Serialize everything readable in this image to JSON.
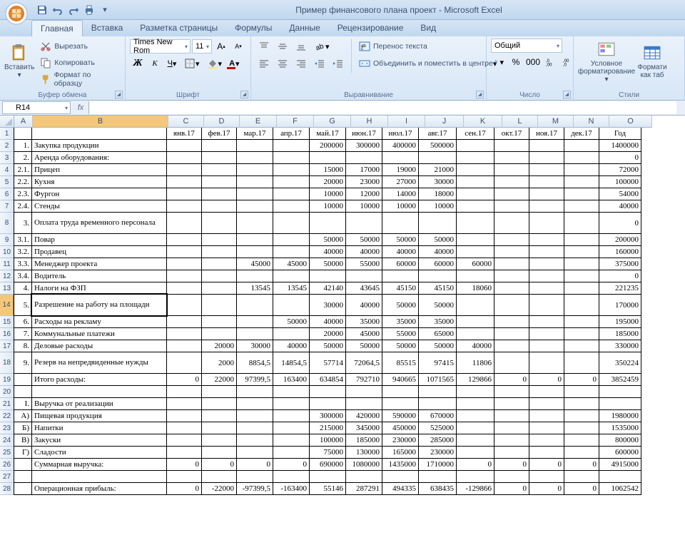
{
  "title": "Пример финансового плана проект - Microsoft Excel",
  "tabs": [
    "Главная",
    "Вставка",
    "Разметка страницы",
    "Формулы",
    "Данные",
    "Рецензирование",
    "Вид"
  ],
  "ribbon": {
    "paste": "Вставить",
    "cut": "Вырезать",
    "copy": "Копировать",
    "fmt_painter": "Формат по образцу",
    "g_clip": "Буфер обмена",
    "font_name": "Times New Rom",
    "font_size": "11",
    "g_font": "Шрифт",
    "wrap": "Перенос текста",
    "merge": "Объединить и поместить в центре",
    "g_align": "Выравнивание",
    "num_fmt": "Общий",
    "g_num": "Число",
    "cond_fmt_l1": "Условное",
    "cond_fmt_l2": "форматирование",
    "fmt_tbl_l1": "Формати",
    "fmt_tbl_l2": "как таб",
    "g_styles": "Стили"
  },
  "namebox": "R14",
  "columns": [
    "A",
    "B",
    "C",
    "D",
    "E",
    "F",
    "G",
    "H",
    "I",
    "J",
    "K",
    "L",
    "M",
    "N",
    "O"
  ],
  "col_widths": [
    "cA",
    "cB",
    "cC",
    "cD",
    "cE",
    "cF",
    "cG",
    "cH",
    "cI",
    "cJ",
    "cK",
    "cL",
    "cM",
    "cN",
    "cO"
  ],
  "active_cell": {
    "row": 14,
    "col": 1
  },
  "header_row": {
    "n": 1,
    "cells": [
      "",
      "",
      "янв.17",
      "фев.17",
      "мар.17",
      "апр.17",
      "май.17",
      "июн.17",
      "июл.17",
      "авг.17",
      "сен.17",
      "окт.17",
      "ноя.17",
      "дек.17",
      "Год"
    ],
    "align": [
      "",
      "",
      "c",
      "c",
      "c",
      "c",
      "c",
      "c",
      "c",
      "c",
      "c",
      "c",
      "c",
      "c",
      "c"
    ]
  },
  "rows": [
    {
      "n": 2,
      "cells": [
        "1.",
        "Закупка продукции",
        "",
        "",
        "",
        "",
        "200000",
        "300000",
        "400000",
        "500000",
        "",
        "",
        "",
        "",
        "1400000"
      ]
    },
    {
      "n": 3,
      "cells": [
        "2.",
        "Аренда оборудования:",
        "",
        "",
        "",
        "",
        "",
        "",
        "",
        "",
        "",
        "",
        "",
        "",
        "0"
      ]
    },
    {
      "n": 4,
      "cells": [
        "2.1.",
        "Прицеп",
        "",
        "",
        "",
        "",
        "15000",
        "17000",
        "19000",
        "21000",
        "",
        "",
        "",
        "",
        "72000"
      ]
    },
    {
      "n": 5,
      "cells": [
        "2.2.",
        "Кухня",
        "",
        "",
        "",
        "",
        "20000",
        "23000",
        "27000",
        "30000",
        "",
        "",
        "",
        "",
        "100000"
      ]
    },
    {
      "n": 6,
      "cells": [
        "2.3.",
        "Фургон",
        "",
        "",
        "",
        "",
        "10000",
        "12000",
        "14000",
        "18000",
        "",
        "",
        "",
        "",
        "54000"
      ]
    },
    {
      "n": 7,
      "cells": [
        "2.4.",
        "Стенды",
        "",
        "",
        "",
        "",
        "10000",
        "10000",
        "10000",
        "10000",
        "",
        "",
        "",
        "",
        "40000"
      ]
    },
    {
      "n": 8,
      "tall": true,
      "cells": [
        "3.",
        "Оплата труда временного персонала",
        "",
        "",
        "",
        "",
        "",
        "",
        "",
        "",
        "",
        "",
        "",
        "",
        "0"
      ]
    },
    {
      "n": 9,
      "cells": [
        "3.1.",
        "Повар",
        "",
        "",
        "",
        "",
        "50000",
        "50000",
        "50000",
        "50000",
        "",
        "",
        "",
        "",
        "200000"
      ]
    },
    {
      "n": 10,
      "cells": [
        "3.2.",
        "Продавец",
        "",
        "",
        "",
        "",
        "40000",
        "40000",
        "40000",
        "40000",
        "",
        "",
        "",
        "",
        "160000"
      ]
    },
    {
      "n": 11,
      "cells": [
        "3.3.",
        "Менеджер проекта",
        "",
        "",
        "45000",
        "45000",
        "50000",
        "55000",
        "60000",
        "60000",
        "60000",
        "",
        "",
        "",
        "375000"
      ]
    },
    {
      "n": 12,
      "cells": [
        "3.4.",
        "Водитель",
        "",
        "",
        "",
        "",
        "",
        "",
        "",
        "",
        "",
        "",
        "",
        "",
        "0"
      ]
    },
    {
      "n": 13,
      "cells": [
        "4.",
        "Налоги на ФЗП",
        "",
        "",
        "13545",
        "13545",
        "42140",
        "43645",
        "45150",
        "45150",
        "18060",
        "",
        "",
        "",
        "221235"
      ]
    },
    {
      "n": 14,
      "tall": true,
      "cells": [
        "5.",
        "Разрешение на работу на площади",
        "",
        "",
        "",
        "",
        "30000",
        "40000",
        "50000",
        "50000",
        "",
        "",
        "",
        "",
        "170000"
      ]
    },
    {
      "n": 15,
      "cells": [
        "6.",
        "Расходы на рекламу",
        "",
        "",
        "",
        "50000",
        "40000",
        "35000",
        "35000",
        "35000",
        "",
        "",
        "",
        "",
        "195000"
      ]
    },
    {
      "n": 16,
      "cells": [
        "7.",
        "Коммунальные платежи",
        "",
        "",
        "",
        "",
        "20000",
        "45000",
        "55000",
        "65000",
        "",
        "",
        "",
        "",
        "185000"
      ]
    },
    {
      "n": 17,
      "cells": [
        "8.",
        "Деловые расходы",
        "",
        "20000",
        "30000",
        "40000",
        "50000",
        "50000",
        "50000",
        "50000",
        "40000",
        "",
        "",
        "",
        "330000"
      ]
    },
    {
      "n": 18,
      "tall": true,
      "cells": [
        "9.",
        "Резерв на непредвиденные нужды",
        "",
        "2000",
        "8854,5",
        "14854,5",
        "57714",
        "72064,5",
        "85515",
        "97415",
        "11806",
        "",
        "",
        "",
        "350224"
      ]
    },
    {
      "n": 19,
      "cells": [
        "",
        "Итого расходы:",
        "0",
        "22000",
        "97399,5",
        "163400",
        "634854",
        "792710",
        "940665",
        "1071565",
        "129866",
        "0",
        "0",
        "0",
        "3852459"
      ]
    },
    {
      "n": 20,
      "cells": [
        "",
        "",
        "",
        "",
        "",
        "",
        "",
        "",
        "",
        "",
        "",
        "",
        "",
        "",
        ""
      ]
    },
    {
      "n": 21,
      "cells": [
        "I.",
        "Выручка от реализации",
        "",
        "",
        "",
        "",
        "",
        "",
        "",
        "",
        "",
        "",
        "",
        "",
        ""
      ]
    },
    {
      "n": 22,
      "cells": [
        "А)",
        "Пищевая продукция",
        "",
        "",
        "",
        "",
        "300000",
        "420000",
        "590000",
        "670000",
        "",
        "",
        "",
        "",
        "1980000"
      ]
    },
    {
      "n": 23,
      "cells": [
        "Б)",
        "Напитки",
        "",
        "",
        "",
        "",
        "215000",
        "345000",
        "450000",
        "525000",
        "",
        "",
        "",
        "",
        "1535000"
      ]
    },
    {
      "n": 24,
      "cells": [
        "В)",
        "Закуски",
        "",
        "",
        "",
        "",
        "100000",
        "185000",
        "230000",
        "285000",
        "",
        "",
        "",
        "",
        "800000"
      ]
    },
    {
      "n": 25,
      "cells": [
        "Г)",
        "Сладости",
        "",
        "",
        "",
        "",
        "75000",
        "130000",
        "165000",
        "230000",
        "",
        "",
        "",
        "",
        "600000"
      ]
    },
    {
      "n": 26,
      "cells": [
        "",
        "Суммарная выручка:",
        "0",
        "0",
        "0",
        "0",
        "690000",
        "1080000",
        "1435000",
        "1710000",
        "0",
        "0",
        "0",
        "0",
        "4915000"
      ]
    },
    {
      "n": 27,
      "cells": [
        "",
        "",
        "",
        "",
        "",
        "",
        "",
        "",
        "",
        "",
        "",
        "",
        "",
        "",
        ""
      ]
    },
    {
      "n": 28,
      "cells": [
        "",
        "Операционная прибыль:",
        "0",
        "-22000",
        "-97399,5",
        "-163400",
        "55146",
        "287291",
        "494335",
        "638435",
        "-129866",
        "0",
        "0",
        "0",
        "1062542"
      ]
    }
  ]
}
